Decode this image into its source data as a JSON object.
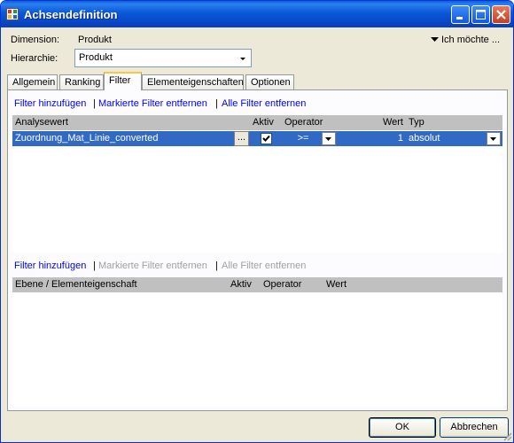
{
  "window": {
    "title": "Achsendefinition"
  },
  "dimension": {
    "label": "Dimension:",
    "value": "Produkt"
  },
  "hierarchy": {
    "label": "Hierarchie:",
    "value": "Produkt"
  },
  "menu": {
    "label": "Ich möchte ..."
  },
  "tabs": [
    {
      "label": "Allgemein"
    },
    {
      "label": "Ranking"
    },
    {
      "label": "Filter"
    },
    {
      "label": "Elementeigenschaften"
    },
    {
      "label": "Optionen"
    }
  ],
  "top_section": {
    "links": {
      "add": "Filter hinzufügen",
      "remove_marked": "Markierte Filter entfernen",
      "remove_all": "Alle Filter entfernen",
      "separator": "|"
    },
    "columns": {
      "analysis_value": "Analysewert",
      "active": "Aktiv",
      "operator": "Operator",
      "value": "Wert",
      "type": "Typ"
    },
    "rows": [
      {
        "analysis_value": "Zuordnung_Mat_Linie_converted",
        "browse": "...",
        "active": true,
        "operator": ">=",
        "value": "1",
        "type": "absolut"
      }
    ]
  },
  "bottom_section": {
    "links": {
      "add": "Filter hinzufügen",
      "remove_marked": "Markierte Filter entfernen",
      "remove_all": "Alle Filter entfernen",
      "separator": "|"
    },
    "columns": {
      "level": "Ebene / Elementeigenschaft",
      "active": "Aktiv",
      "operator": "Operator",
      "value": "Wert"
    }
  },
  "buttons": {
    "ok": "OK",
    "cancel": "Abbrechen"
  },
  "colors": {
    "titlebar": "#0a58d6",
    "selection": "#316ac5",
    "link": "#0000ff",
    "link_disabled": "#a0a0a0",
    "grid_header": "#c0c0c0",
    "active_tab_accent": "#ffc83c"
  },
  "icons": {
    "app": "app-window-icon",
    "minimize": "minimize-icon",
    "maximize": "maximize-icon",
    "close": "close-icon",
    "dropdown": "chevron-down-icon",
    "menu": "triangle-down-icon",
    "checkbox": "checkbox-checked-icon"
  }
}
